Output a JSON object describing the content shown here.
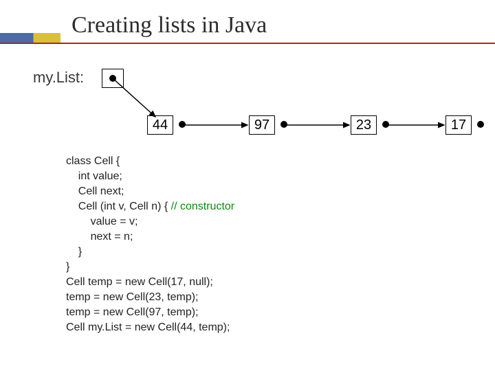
{
  "title": "Creating lists in Java",
  "list_var": "my.List:",
  "nodes": [
    {
      "value": "44"
    },
    {
      "value": "97"
    },
    {
      "value": "23"
    },
    {
      "value": "17"
    }
  ],
  "code": {
    "l1": "class Cell {",
    "l2": "    int value;",
    "l3": "    Cell next;",
    "l4a": "    Cell (int v, Cell n) { ",
    "l4b": "// constructor",
    "l5": "        value = v;",
    "l6": "        next = n;",
    "l7": "    }",
    "l8": "}",
    "l9": "Cell temp = new Cell(17, null);",
    "l10": "temp = new Cell(23, temp);",
    "l11": "temp = new Cell(97, temp);",
    "l12": "Cell my.List = new Cell(44, temp);"
  },
  "chart_data": {
    "type": "table",
    "description": "singly linked list diagram",
    "head_variable": "my.List",
    "sequence": [
      44,
      97,
      23,
      17
    ],
    "terminator": "null (dot, no outgoing arrow)"
  }
}
